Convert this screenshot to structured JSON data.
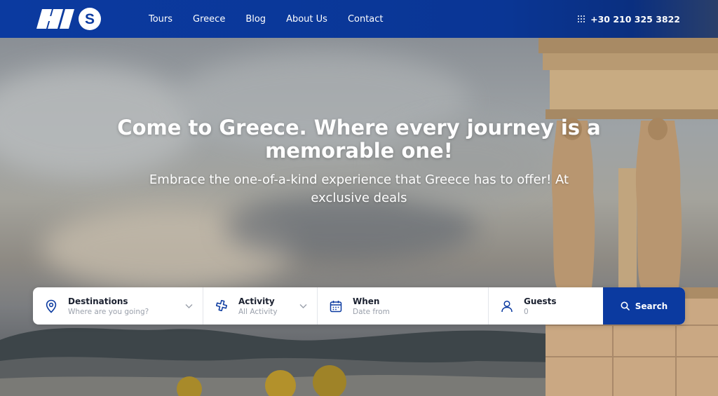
{
  "header": {
    "logo_text": "HIS",
    "nav": [
      "Tours",
      "Greece",
      "Blog",
      "About Us",
      "Contact"
    ],
    "phone": "+30 210 325 3822",
    "phone_icon": "dialpad-icon"
  },
  "hero": {
    "headline": "Come to Greece. Where every journey is a memorable one!",
    "subline": "Embrace the one-of-a-kind experience that Greece has to offer! At exclusive deals"
  },
  "search": {
    "destinations": {
      "label": "Destinations",
      "placeholder": "Where are you going?",
      "icon": "map-pin-icon"
    },
    "activity": {
      "label": "Activity",
      "value": "All Activity",
      "icon": "activity-icon"
    },
    "when": {
      "label": "When",
      "placeholder": "Date from",
      "icon": "calendar-icon"
    },
    "guests": {
      "label": "Guests",
      "value": "0",
      "icon": "user-icon"
    },
    "button_label": "Search",
    "button_icon": "search-icon"
  },
  "colors": {
    "brand": "#0b3aa0",
    "text": "#1b2130",
    "muted": "#9aa0ab"
  }
}
